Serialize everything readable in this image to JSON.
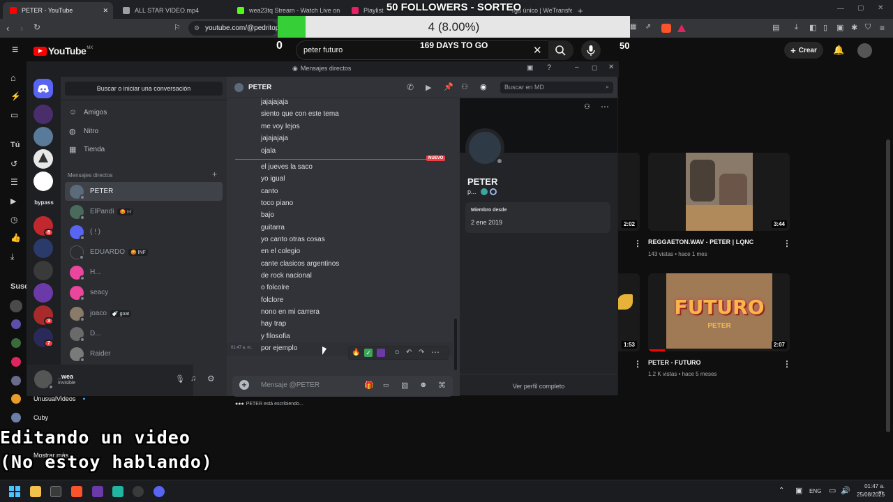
{
  "browser": {
    "tabs": [
      {
        "label": "PETER - YouTube",
        "color": "#ff0000"
      },
      {
        "label": "ALL STAR VIDEO.mp4",
        "color": "#9aa0a6"
      },
      {
        "label": "wea23tq Stream - Watch Live on Kick",
        "color": "#53fc18"
      },
      {
        "label": "Playlist",
        "color": "#e91e63"
      },
      {
        "label": "rga único | WeTransfe",
        "color": "#409fff"
      }
    ],
    "new_tab": "+",
    "url": "youtube.com/@pedritop"
  },
  "overlay": {
    "title": "50 FOLLOWERS - SORTEO",
    "progress_text": "4 (8.00%)",
    "progress_fraction": 0.08,
    "min": "0",
    "max": "50",
    "days": "169 DAYS TO GO"
  },
  "youtube": {
    "logo": "YouTube",
    "region": "MX",
    "search_value": "peter futuro",
    "clear": "✕",
    "create": "Crear",
    "sidebar_labels": {
      "tu": "Tú",
      "subs": "Susc",
      "show_more": "Mostrar más"
    },
    "subscriptions": [
      {
        "name": "UnusualVideos"
      },
      {
        "name": "Cuby"
      }
    ],
    "videos": [
      {
        "duration": "2:02"
      },
      {
        "duration": "3:44",
        "title": "REGGAETON.WAV - PETER | LQNC",
        "meta": "143 vistas • hace 1 mes"
      },
      {
        "duration": "1:53"
      },
      {
        "duration": "2:07",
        "title": "PETER - FUTURO",
        "meta": "1.2 K vistas • hace 5 meses",
        "thumb_text": "FUTURO",
        "thumb_sub": "PETER"
      }
    ]
  },
  "discord": {
    "window_title": "Mensajes directos",
    "find": "Buscar o iniciar una conversación",
    "nav": [
      {
        "label": "Amigos",
        "icon": "friends-icon"
      },
      {
        "label": "Nitro",
        "icon": "nitro-icon"
      },
      {
        "label": "Tienda",
        "icon": "shop-icon"
      }
    ],
    "dm_header": "Mensajes directos",
    "dm_add": "+",
    "dms": [
      {
        "name": "PETER",
        "color": "#5c6b7a",
        "tag": ""
      },
      {
        "name": "ElPandi",
        "color": "#4a6b5c",
        "tag": "😡 I-/"
      },
      {
        "name": "( ! )",
        "color": "#5865f2",
        "tag": ""
      },
      {
        "name": "EDUARDO",
        "color": "#2b2d31",
        "tag": "😡 INF"
      },
      {
        "name": "H...",
        "color": "#eb459e",
        "tag": ""
      },
      {
        "name": "seacy",
        "color": "#eb459e",
        "tag": ""
      },
      {
        "name": "joaco",
        "color": "#8a7a6a",
        "tag": "🍼 goat"
      },
      {
        "name": "D...",
        "color": "#6a6a6a",
        "tag": ""
      },
      {
        "name": "Raider",
        "color": "#7a7a7a",
        "tag": ""
      }
    ],
    "user": {
      "name": "_wea",
      "status": "Invisible"
    },
    "rail": {
      "bypass": "bypass",
      "badges": [
        "8",
        "3",
        "7"
      ]
    },
    "chat": {
      "recipient": "PETER",
      "search_placeholder": "Buscar en MD",
      "new_label": "NUEVO",
      "timestamp": "01:47 a. m.",
      "messages_before": [
        "jajajajaja",
        "siento que con este tema",
        "me voy lejos",
        "jajajajaja",
        "ojala"
      ],
      "messages_after": [
        "el jueves la saco",
        "yo igual",
        "canto",
        "toco piano",
        "bajo",
        "guitarra",
        "yo canto otras cosas",
        "en el colegio",
        "cante clasicos argentinos",
        "de rock nacional",
        "o folcolre",
        "folclore",
        "nono en mi carrera",
        "hay trap",
        "y filosofia",
        "por ejemplo"
      ],
      "composer_placeholder": "Mensaje @PETER",
      "typing": "PETER está escribiendo..."
    },
    "profile": {
      "name": "PETER",
      "tag": "p...",
      "member_since_label": "Miembro desde",
      "member_since": "2 ene 2019",
      "view_full": "Ver perfil completo"
    }
  },
  "captions": {
    "line1": "Editando un video",
    "line2": "(No estoy hablando)"
  },
  "taskbar": {
    "lang": "ENG",
    "time": "01:47 a. m.",
    "date": "25/08/2025"
  }
}
